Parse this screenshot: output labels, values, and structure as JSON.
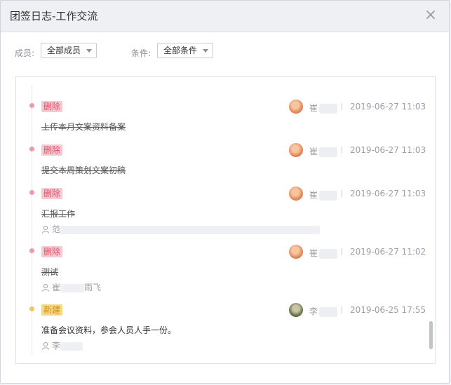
{
  "dialog": {
    "title": "团签日志-工作交流",
    "close_symbol": "×"
  },
  "filters": {
    "member_label": "成员:",
    "member_value": "全部成员",
    "condition_label": "条件:",
    "condition_value": "全部条件"
  },
  "entries": [
    {
      "badge": "删除",
      "content": "上传本月文案资料备案",
      "author": "崔",
      "time": "2019-06-27 11:03"
    },
    {
      "badge": "删除",
      "content": "提交本周策划文案初稿",
      "author": "崔",
      "time": "2019-06-27 11:03"
    },
    {
      "badge": "删除",
      "content": "汇报工作",
      "author": "崔",
      "time": "2019-06-27 11:03",
      "members": "范"
    },
    {
      "badge": "删除",
      "content": "测试",
      "author": "崔",
      "time": "2019-06-27 11:02",
      "members_prefix": "崔",
      "members_suffix": "雨飞"
    },
    {
      "badge": "新建",
      "content": "准备会议资料，参会人员人手一份。",
      "author": "李",
      "time": "2019-06-25 17:55",
      "members": "李"
    }
  ],
  "colors": {
    "delete_badge_bg": "#f7c9d1",
    "delete_badge_text": "#e0506a",
    "new_badge_bg": "#f7d884",
    "new_badge_text": "#d28a12",
    "delete_dot": "#ef9aaa",
    "new_dot": "#f2c36b"
  },
  "icons": {
    "close": "close-icon",
    "dropdown": "chevron-down-icon",
    "members": "person-icon",
    "avatar": "avatar"
  }
}
